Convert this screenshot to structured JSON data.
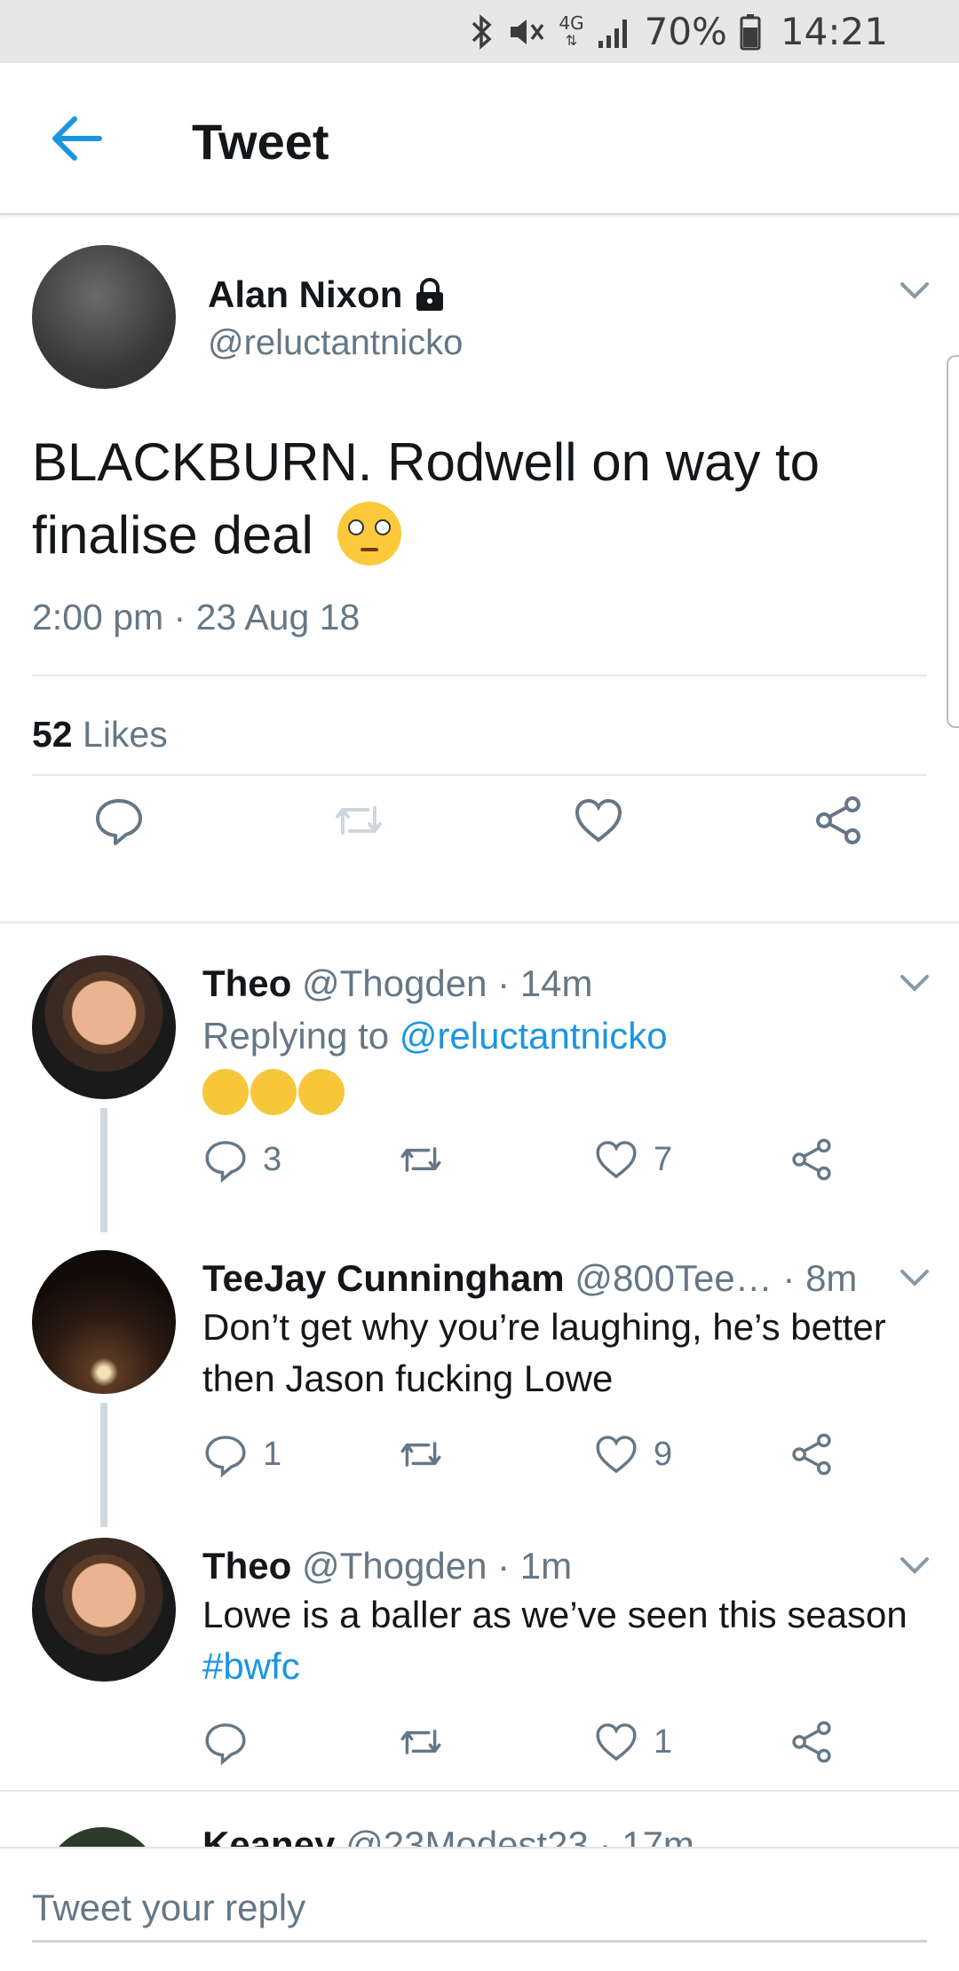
{
  "status_bar": {
    "battery_pct": "70%",
    "time": "14:21",
    "network": "4G"
  },
  "header": {
    "title": "Tweet"
  },
  "main_tweet": {
    "name": "Alan Nixon",
    "handle": "@reluctantnicko",
    "text": "BLACKBURN. Rodwell on way to finalise deal",
    "timestamp": "2:00 pm · 23 Aug 18",
    "likes_count": "52",
    "likes_label": "Likes"
  },
  "replies": [
    {
      "name": "Theo",
      "meta": "@Thogden · 14m",
      "replying_prefix": "Replying to",
      "replying_to": "@reluctantnicko",
      "reply_count": "3",
      "like_count": "7"
    },
    {
      "name": "TeeJay Cunningham",
      "meta": "@800Tee…  · 8m",
      "text": "Don’t get why you’re laughing, he’s better then Jason fucking Lowe",
      "reply_count": "1",
      "like_count": "9"
    },
    {
      "name": "Theo",
      "meta": "@Thogden · 1m",
      "text": "Lowe is a baller as we’ve seen this season",
      "hashtag": "#bwfc",
      "reply_count": "",
      "like_count": "1"
    },
    {
      "name": "Keaney",
      "meta": "@23Modest23 · 17m"
    }
  ],
  "compose": {
    "placeholder": "Tweet your reply"
  },
  "colors": {
    "accent": "#1b95e0",
    "secondary_text": "#657786"
  }
}
